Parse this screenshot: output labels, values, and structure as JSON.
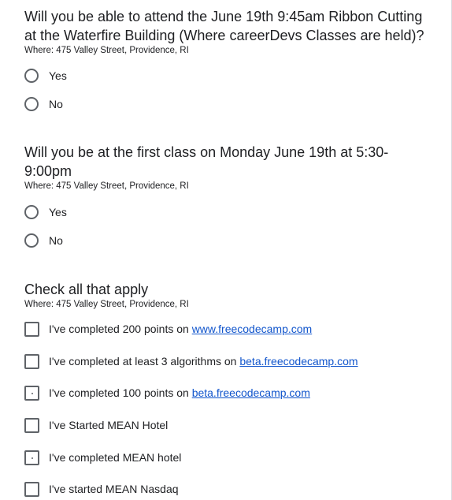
{
  "questions": [
    {
      "title": "Will you be able to attend the June 19th 9:45am Ribbon Cutting at the Waterfire Building (Where careerDevs Classes are held)?",
      "description": "Where: 475 Valley Street, Providence, RI",
      "type": "radio",
      "options": [
        {
          "label": "Yes"
        },
        {
          "label": "No"
        }
      ]
    },
    {
      "title": "Will you be at the first class on Monday June 19th at 5:30-9:00pm",
      "description": "Where: 475 Valley Street, Providence, RI",
      "type": "radio",
      "options": [
        {
          "label": "Yes"
        },
        {
          "label": "No"
        }
      ]
    },
    {
      "title": "Check all that apply",
      "description": "Where: 475 Valley Street, Providence, RI",
      "type": "checkbox",
      "options": [
        {
          "label": "I've completed 200 points on ",
          "link": "www.freecodecamp.com"
        },
        {
          "label": "I've completed at least 3 algorithms on ",
          "link": "beta.freecodecamp.com"
        },
        {
          "label": "I've completed 100 points on ",
          "link": "beta.freecodecamp.com"
        },
        {
          "label": "I've Started MEAN Hotel",
          "link": ""
        },
        {
          "label": "I've completed MEAN hotel",
          "link": ""
        },
        {
          "label": "I've started MEAN Nasdaq",
          "link": ""
        }
      ]
    }
  ]
}
